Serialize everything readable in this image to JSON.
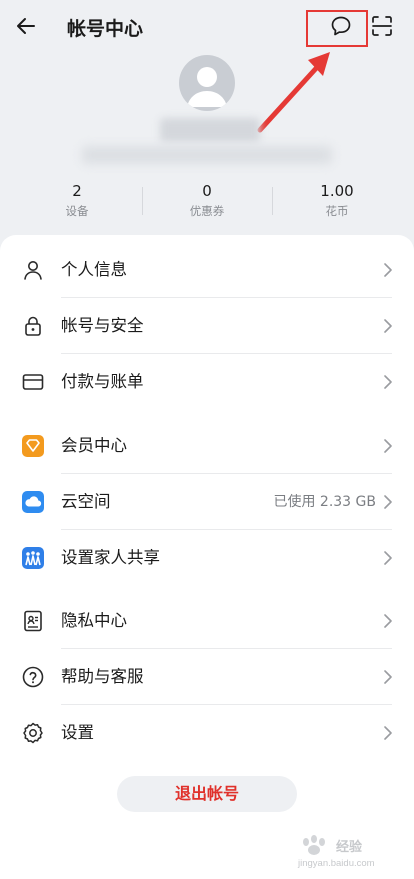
{
  "header": {
    "title": "帐号中心"
  },
  "stats": [
    {
      "value": "2",
      "label": "设备"
    },
    {
      "value": "0",
      "label": "优惠券"
    },
    {
      "value": "1.00",
      "label": "花币"
    }
  ],
  "menu": [
    {
      "label": "个人信息",
      "icon": "person-icon"
    },
    {
      "label": "帐号与安全",
      "icon": "lock-icon"
    },
    {
      "label": "付款与账单",
      "icon": "card-icon"
    },
    {
      "label": "会员中心",
      "icon": "member-icon"
    },
    {
      "label": "云空间",
      "icon": "cloud-icon",
      "right": "已使用 2.33 GB"
    },
    {
      "label": "设置家人共享",
      "icon": "family-icon"
    },
    {
      "label": "隐私中心",
      "icon": "privacy-icon"
    },
    {
      "label": "帮助与客服",
      "icon": "help-icon"
    },
    {
      "label": "设置",
      "icon": "settings-icon"
    }
  ],
  "logout_label": "退出帐号",
  "watermark": {
    "text": "经验",
    "sub": "jingyan.baidu.com"
  },
  "colors": {
    "accent_red": "#e0312b",
    "annotation_red": "#e53935",
    "member_orange": "#f39a1e",
    "cloud_blue": "#2f8cf0"
  }
}
